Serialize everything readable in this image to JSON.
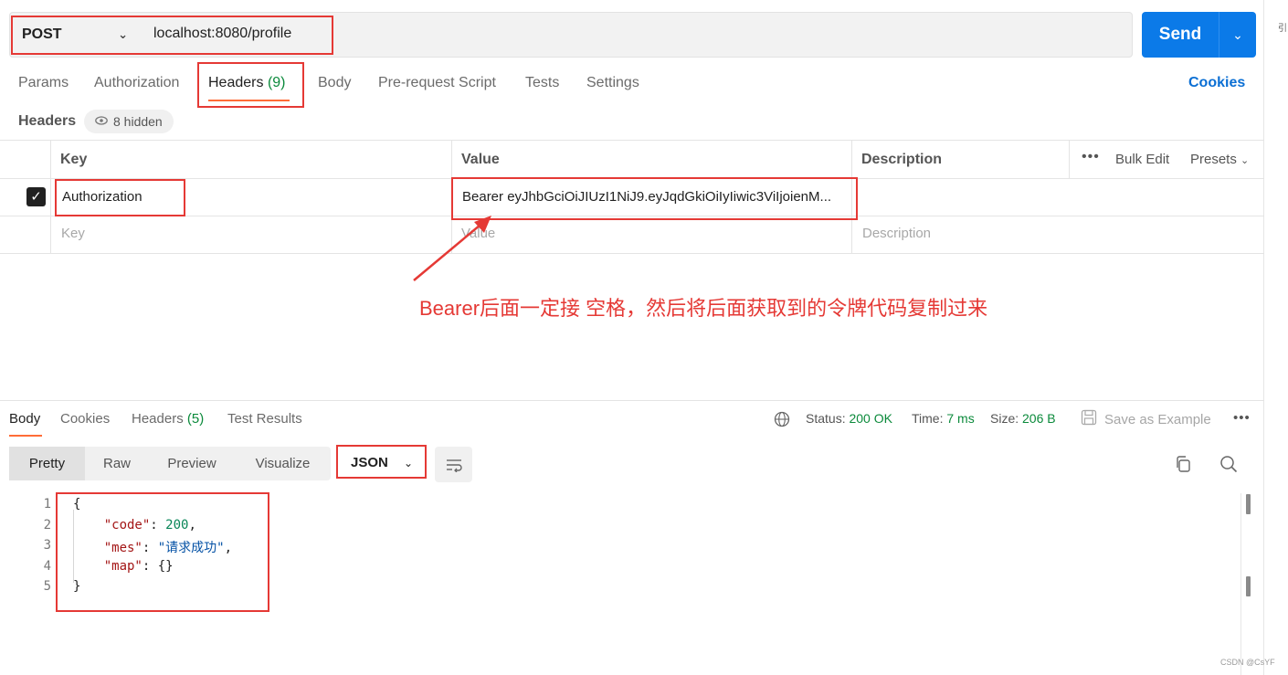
{
  "request": {
    "method": "POST",
    "url": "localhost:8080/profile",
    "send_label": "Send"
  },
  "edge_glyph": "引",
  "tabs": [
    {
      "label": "Params"
    },
    {
      "label": "Authorization"
    },
    {
      "label": "Headers",
      "count": "(9)"
    },
    {
      "label": "Body"
    },
    {
      "label": "Pre-request Script"
    },
    {
      "label": "Tests"
    },
    {
      "label": "Settings"
    }
  ],
  "cookies_link": "Cookies",
  "headers_section": {
    "title": "Headers",
    "hidden_label": "8 hidden"
  },
  "table": {
    "columns": [
      "Key",
      "Value",
      "Description"
    ],
    "actions": {
      "bulk_edit": "Bulk Edit",
      "presets": "Presets"
    },
    "rows": [
      {
        "checked": true,
        "key": "Authorization",
        "value": "Bearer eyJhbGciOiJIUzI1NiJ9.eyJqdGkiOiIyIiwic3ViIjoienM..."
      }
    ],
    "placeholders": {
      "key": "Key",
      "value": "Value",
      "description": "Description"
    }
  },
  "annotation": "Bearer后面一定接 空格，然后将后面获取到的令牌代码复制过来",
  "response": {
    "tabs": [
      {
        "label": "Body"
      },
      {
        "label": "Cookies"
      },
      {
        "label": "Headers",
        "count": "(5)"
      },
      {
        "label": "Test Results"
      }
    ],
    "status_label": "Status:",
    "status_value": "200 OK",
    "time_label": "Time:",
    "time_value": "7 ms",
    "size_label": "Size:",
    "size_value": "206 B",
    "save_example": "Save as Example",
    "view_modes": [
      "Pretty",
      "Raw",
      "Preview",
      "Visualize"
    ],
    "format": "JSON",
    "lines": [
      "1",
      "2",
      "3",
      "4",
      "5"
    ],
    "json": {
      "open": "{",
      "code_key": "\"code\"",
      "code_val": "200",
      "mes_key": "\"mes\"",
      "mes_val": "\"请求成功\"",
      "map_key": "\"map\"",
      "map_val": "{}",
      "close": "}"
    }
  },
  "watermark": "CSDN @CsYF",
  "icons": [
    "chevron-down-icon",
    "eye-icon",
    "more-icon",
    "globe-icon",
    "save-icon",
    "wrap-lines-icon",
    "copy-icon",
    "search-icon"
  ],
  "colors": {
    "accent": "#0b7ae8",
    "tab_underline": "#ff6c37",
    "annotation": "#e53935",
    "status_ok": "#0b8a3b"
  }
}
